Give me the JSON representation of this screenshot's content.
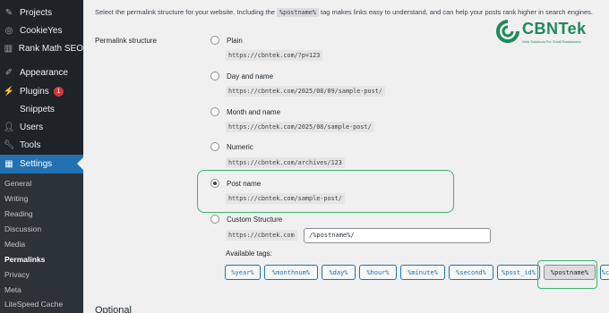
{
  "sidebar": {
    "top_items": [
      {
        "label": "Projects",
        "icon": "pin-icon"
      },
      {
        "label": "CookieYes",
        "icon": "cookie-icon"
      },
      {
        "label": "Rank Math SEO",
        "icon": "chart-icon"
      },
      {
        "label": "Appearance",
        "icon": "paintbrush-icon"
      },
      {
        "label": "Plugins",
        "icon": "plug-icon",
        "badge": "1"
      },
      {
        "label": "Snippets",
        "icon": ""
      },
      {
        "label": "Users",
        "icon": "user-icon"
      },
      {
        "label": "Tools",
        "icon": "wrench-icon"
      }
    ],
    "settings_label": "Settings",
    "submenu": [
      "General",
      "Writing",
      "Reading",
      "Discussion",
      "Media",
      "Permalinks",
      "Privacy",
      "Meta",
      "LiteSpeed Cache"
    ]
  },
  "main": {
    "intro_before": "Select the permalink structure for your website. Including the",
    "intro_code": "%postname%",
    "intro_after": "tag makes links easy to understand, and can help your posts rank higher in search engines.",
    "field_label": "Permalink structure",
    "options": [
      {
        "label": "Plain",
        "url": "https://cbntek.com/?p=123",
        "checked": false
      },
      {
        "label": "Day and name",
        "url": "https://cbntek.com/2025/08/09/sample-post/",
        "checked": false
      },
      {
        "label": "Month and name",
        "url": "https://cbntek.com/2025/08/sample-post/",
        "checked": false
      },
      {
        "label": "Numeric",
        "url": "https://cbntek.com/archives/123",
        "checked": false
      },
      {
        "label": "Post name",
        "url": "https://cbntek.com/sample-post/",
        "checked": true
      }
    ],
    "custom_label": "Custom Structure",
    "custom_base": "https://cbntek.com",
    "custom_value": "/%postname%/",
    "available_tags_label": "Available tags:",
    "tags": [
      "%year%",
      "%monthnum%",
      "%day%",
      "%hour%",
      "%minute%",
      "%second%",
      "%post_id%",
      "%postname%",
      "%c"
    ],
    "active_tag": "%postname%",
    "optional_heading": "Optional"
  },
  "logo": {
    "name_cbn": "CBN",
    "name_tek": "Tek",
    "tagline": "Web Solutions For Small Businesses",
    "color": "#1e8a5a"
  },
  "colors": {
    "sidebar_bg": "#1d2327",
    "active_menu": "#2271b1",
    "highlight": "#3cb371"
  }
}
